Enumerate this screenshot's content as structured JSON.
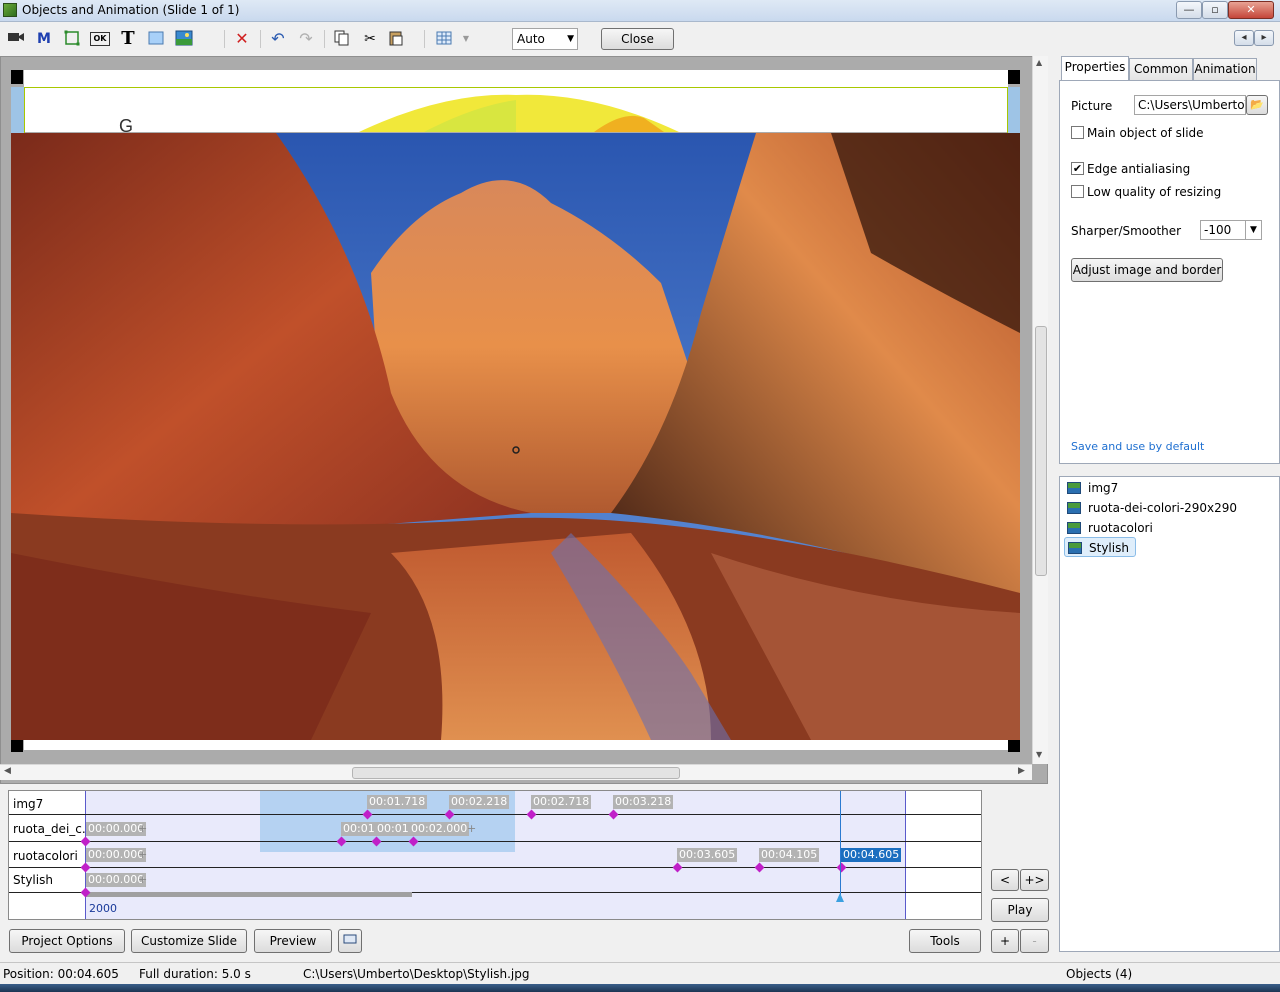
{
  "window": {
    "title": "Objects and Animation  (Slide 1 of 1)",
    "minimize_icon": "minimize-icon",
    "maximize_icon": "maximize-icon",
    "close_icon": "close-icon"
  },
  "toolbar": {
    "zoom_value": "Auto",
    "close_label": "Close",
    "icons": [
      "camera-icon",
      "mask-icon",
      "frame-icon",
      "button-icon",
      "text-icon",
      "rectangle-icon",
      "image-icon",
      "delete-icon",
      "undo-icon",
      "redo-icon",
      "copy-icon",
      "cut-icon",
      "paste-icon",
      "grid-icon"
    ],
    "text_icon_glyph": "T",
    "mask_icon_glyph": "M",
    "button_icon_glyph": "OK",
    "nav_prev": "◂",
    "nav_next": "▸"
  },
  "properties": {
    "tabs": [
      "Properties",
      "Common",
      "Animation"
    ],
    "picture_label": "Picture",
    "picture_value": "C:\\Users\\Umberto\\Desktop\\Stylish.jpg",
    "main_object_label": "Main object of slide",
    "main_object_checked": false,
    "edge_antialiasing_label": "Edge antialiasing",
    "edge_antialiasing_checked": true,
    "low_quality_label": "Low quality of resizing",
    "low_quality_checked": false,
    "sharper_label": "Sharper/Smoother",
    "sharper_value": "-100",
    "adjust_button": "Adjust image and border",
    "save_default_link": "Save and use by default"
  },
  "objects": {
    "items": [
      "img7",
      "ruota-dei-colori-290x290",
      "ruotacolori",
      "Stylish"
    ],
    "selected": "Stylish"
  },
  "timeline": {
    "tracks": [
      "img7",
      "ruota_dei_c...",
      "ruotacolori",
      "Stylish"
    ],
    "labels": {
      "img7_1": "00:01.718",
      "img7_2": "00:02.218",
      "img7_3": "00:02.718",
      "img7_4": "00:03.218",
      "ruota_1": "00:00.000",
      "ruota_2": "00:01.500",
      "ruota_3": "00:01.700",
      "ruota_4": "00:02.000",
      "ruotacolori_1": "00:00.000",
      "ruotacolori_2": "00:03.605",
      "ruotacolori_3": "00:04.105",
      "ruotacolori_4": "00:04.605",
      "stylish_1": "00:00.000"
    },
    "plus": "+",
    "scale_label": "2000"
  },
  "side_buttons": {
    "prev": "<",
    "next": "+>",
    "play": "Play",
    "add": "+",
    "remove": "-"
  },
  "bottom_buttons": {
    "project_options": "Project Options",
    "customize_slide": "Customize Slide",
    "preview": "Preview",
    "tools": "Tools"
  },
  "status": {
    "position": "Position:  00:04.605",
    "duration": "Full duration:  5.0 s",
    "file": "C:\\Users\\Umberto\\Desktop\\Stylish.jpg",
    "objects": "Objects (4)"
  },
  "colors": {
    "accent": "#1b6fc0",
    "keyframe": "#c020c8",
    "selection": "#a8ccf0"
  }
}
